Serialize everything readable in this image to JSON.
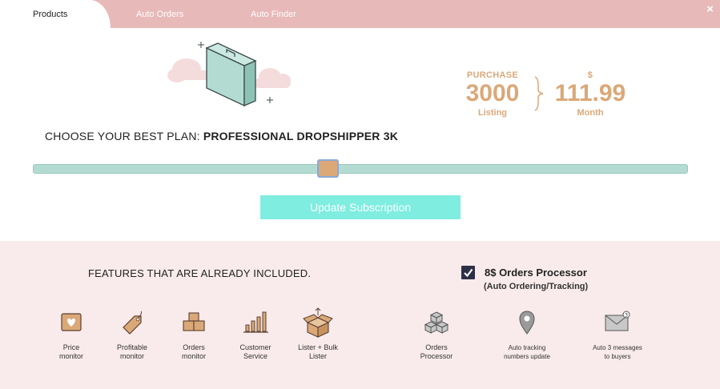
{
  "tabs": [
    {
      "label": "Products"
    },
    {
      "label": "Auto Orders"
    },
    {
      "label": "Auto Finder"
    }
  ],
  "close_label": "×",
  "pricing": {
    "listing_caption": "PURCHASE",
    "listing_value": "3000",
    "listing_unit": "Listing",
    "price_caption": "$",
    "price_value": "111.99",
    "price_unit": "Month"
  },
  "plan": {
    "prefix": "CHOOSE YOUR BEST PLAN: ",
    "name": "PROFESSIONAL DROPSHIPPER 3K"
  },
  "slider": {
    "position": 0.45
  },
  "update_button_label": "Update Subscription",
  "features": {
    "title": "FEATURES THAT ARE ALREADY INCLUDED.",
    "processor_title": "8$ Orders Processor",
    "processor_subtitle": "(Auto Ordering/Tracking)",
    "processor_checked": true,
    "items": [
      {
        "label": "Price\nmonitor",
        "icon": "heart-tag-icon"
      },
      {
        "label": "Profitable\nmonitor",
        "icon": "price-tag-icon"
      },
      {
        "label": "Orders\nmonitor",
        "icon": "boxes-icon"
      },
      {
        "label": "Customer\nService",
        "icon": "bar-chart-icon"
      },
      {
        "label": "Lister + Bulk\nLister",
        "icon": "open-box-icon"
      }
    ],
    "processor_items": [
      {
        "label": "Orders\nProcessor",
        "icon": "gray-boxes-icon"
      },
      {
        "label": "Auto tracking\nnumbers update",
        "icon": "location-pin-icon"
      },
      {
        "label": "Auto 3 messages\nto buyers",
        "icon": "envelope-icon"
      }
    ]
  },
  "colors": {
    "tab_bar": "#e8b9b9",
    "accent": "#dba878",
    "slider_track": "#b3dbd2",
    "button": "#7fede0",
    "panel": "#f9ebeb"
  }
}
